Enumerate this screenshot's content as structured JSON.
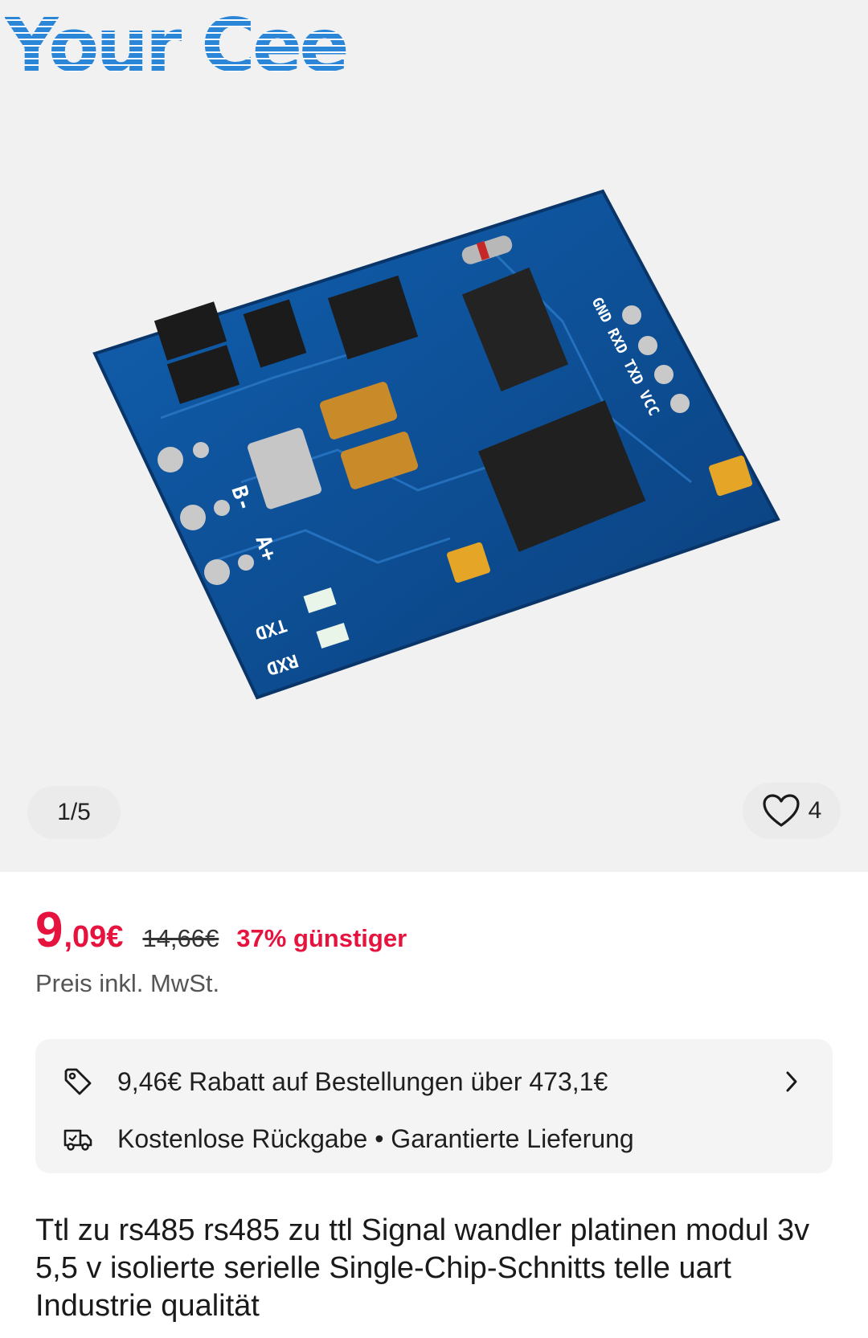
{
  "gallery": {
    "brand_logo": "Your Cee",
    "image_counter": "1/5",
    "favorites_count": "4",
    "pcb_labels": {
      "gnd_rxd_txd_vcc": "GND RXD TXD VCC",
      "txd": "TXD",
      "rxd": "RXD",
      "b_minus": "B-",
      "a_plus": "A+"
    }
  },
  "price": {
    "integer": "9",
    "decimal": ",09€",
    "original": "14,66€",
    "discount": "37% günstiger",
    "vat_note": "Preis inkl. MwSt."
  },
  "promo": {
    "coupon_text": "9,46€ Rabatt auf Bestellungen über 473,1€",
    "delivery_text": "Kostenlose Rückgabe • Garantierte Lieferung"
  },
  "product": {
    "title": "Ttl zu rs485 rs485 zu ttl Signal wandler platinen modul 3v 5,5 v isolierte serielle Single-Chip-Schnitts telle uart Industrie qualität"
  },
  "colors": {
    "accent_price": "#e5133e",
    "pcb_blue": "#0d4f96",
    "logo_blue": "#2b86d8"
  }
}
